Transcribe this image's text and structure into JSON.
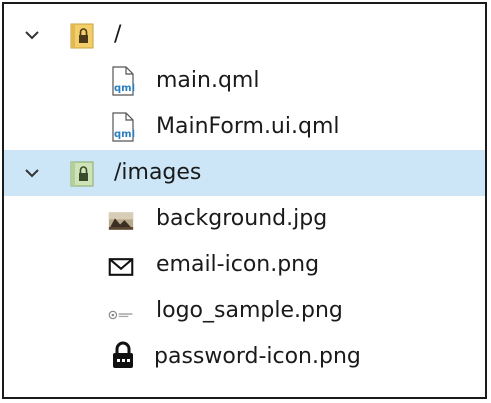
{
  "tree": {
    "items": [
      {
        "label": "/",
        "icon": "folder-lock-icon",
        "expanded": true
      },
      {
        "label": "main.qml",
        "icon": "qml-file-icon"
      },
      {
        "label": "MainForm.ui.qml",
        "icon": "qml-file-icon"
      },
      {
        "label": "/images",
        "icon": "folder-lock-icon",
        "expanded": true,
        "selected": true
      },
      {
        "label": "background.jpg",
        "icon": "image-file-icon"
      },
      {
        "label": "email-icon.png",
        "icon": "envelope-icon"
      },
      {
        "label": "logo_sample.png",
        "icon": "logo-thumbnail-icon"
      },
      {
        "label": "password-icon.png",
        "icon": "padlock-icon"
      }
    ],
    "qml_badge": "qml"
  },
  "colors": {
    "selection": "#cde6f7",
    "folder": "#f3cf6a",
    "qml_badge": "#2a7fc1"
  }
}
